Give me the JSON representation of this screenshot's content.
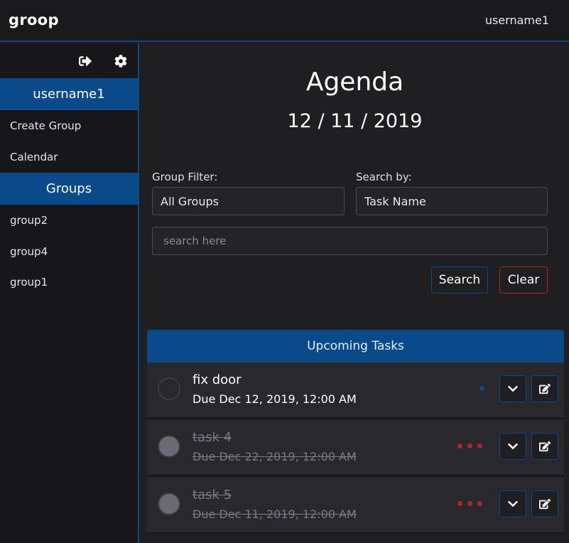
{
  "app": {
    "brand": "groop",
    "user": "username1"
  },
  "sidebar": {
    "username": "username1",
    "links": [
      {
        "label": "Create Group"
      },
      {
        "label": "Calendar"
      }
    ],
    "groups_header": "Groups",
    "groups": [
      {
        "label": "group2"
      },
      {
        "label": "group4"
      },
      {
        "label": "group1"
      }
    ],
    "icons": [
      "sign-out-icon",
      "gear-icon"
    ]
  },
  "agenda": {
    "title": "Agenda",
    "date": "12 / 11 / 2019"
  },
  "filters": {
    "group_label": "Group Filter:",
    "group_value": "All Groups",
    "search_by_label": "Search by:",
    "search_by_value": "Task Name",
    "search_placeholder": "search here",
    "search_button": "Search",
    "clear_button": "Clear"
  },
  "tasks": {
    "header": "Upcoming Tasks",
    "items": [
      {
        "name": "fix door",
        "due": "Due Dec 12, 2019, 12:00 AM",
        "completed": false,
        "priority_dots": 1,
        "priority_color": "#0a4a8a"
      },
      {
        "name": "task 4",
        "due": "Due Dec 22, 2019, 12:00 AM",
        "completed": true,
        "priority_dots": 3,
        "priority_color": "#b0232f"
      },
      {
        "name": "task 5",
        "due": "Due Dec 11, 2019, 12:00 AM",
        "completed": true,
        "priority_dots": 3,
        "priority_color": "#b0232f"
      }
    ]
  },
  "colors": {
    "accent": "#0a4a8a",
    "danger": "#b0232f",
    "background": "#1f1f22"
  }
}
